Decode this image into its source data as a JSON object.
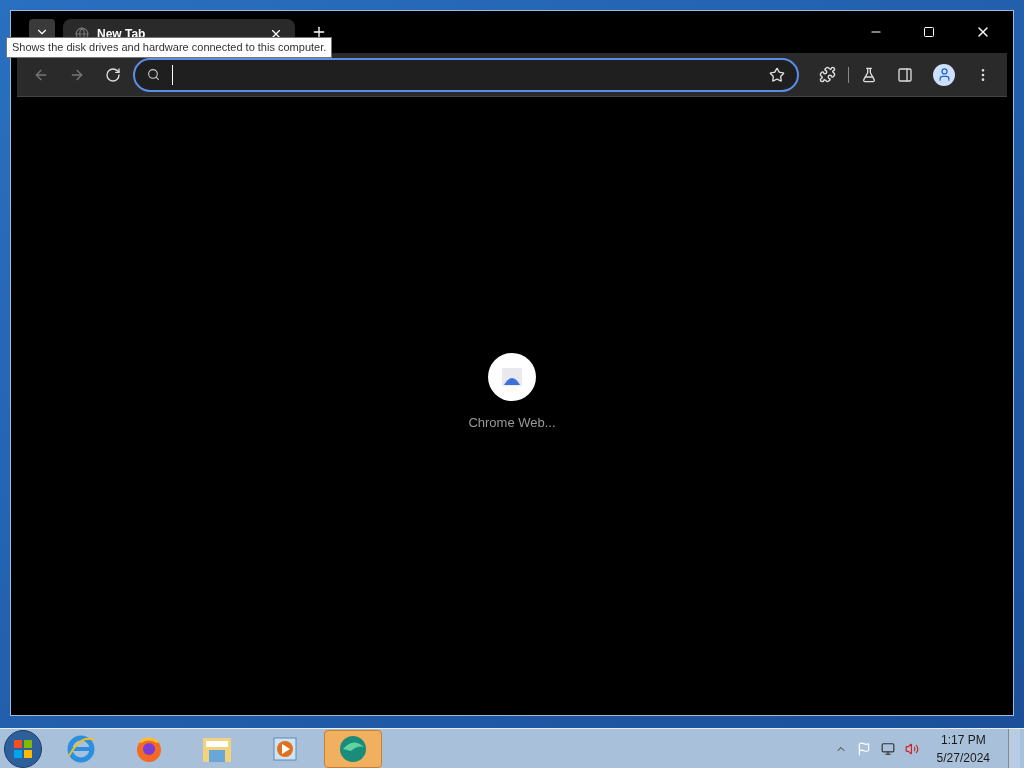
{
  "browser": {
    "tabs": [
      {
        "title": "New Tab",
        "selected": true
      }
    ],
    "address": {
      "focused": true
    },
    "content": {
      "loading_label": "Chrome Web..."
    }
  },
  "tooltip": {
    "text": "Shows the disk drives and hardware connected to this computer."
  },
  "taskbar": {
    "apps": [
      {
        "kind": "ie",
        "selected": false
      },
      {
        "kind": "firefox",
        "selected": false
      },
      {
        "kind": "explorer",
        "selected": false
      },
      {
        "kind": "media",
        "selected": false
      },
      {
        "kind": "edge",
        "selected": true
      }
    ],
    "clock": {
      "time": "1:17 PM",
      "date": "5/27/2024"
    }
  }
}
